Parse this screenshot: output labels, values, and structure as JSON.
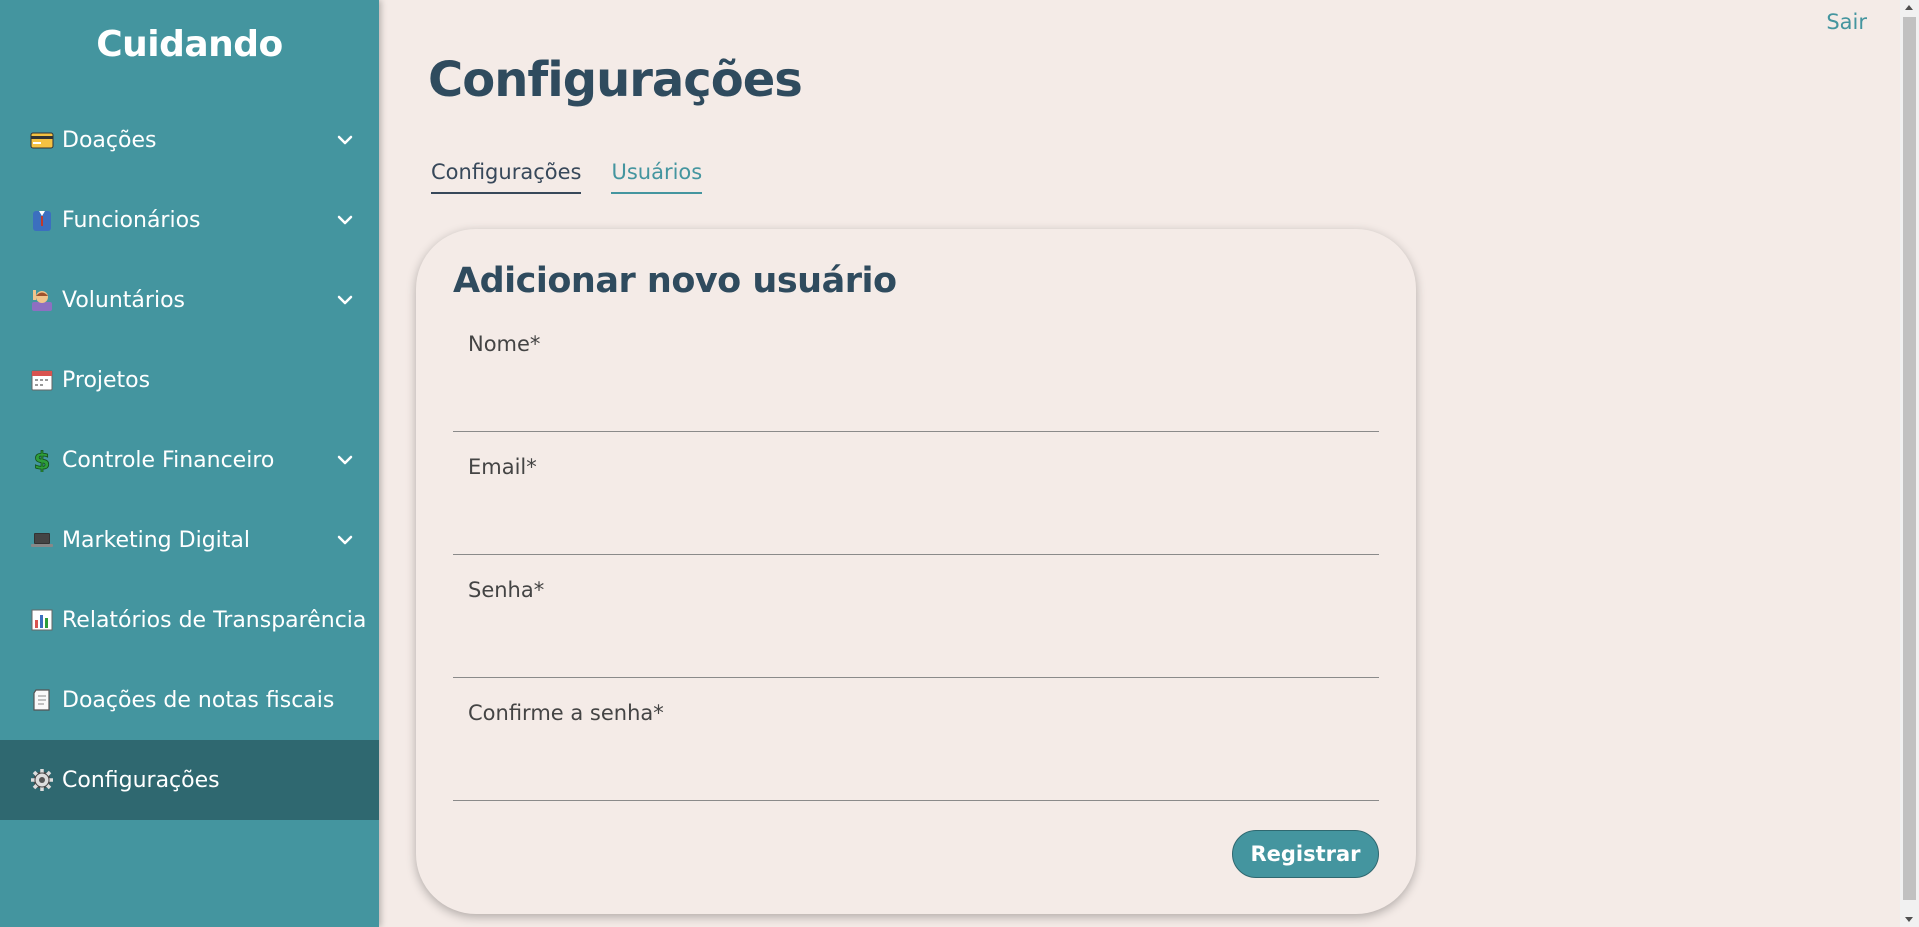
{
  "sidebar": {
    "brand": "Cuidando",
    "items": [
      {
        "label": "Doações",
        "icon": "credit-card-icon",
        "expandable": true
      },
      {
        "label": "Funcionários",
        "icon": "employee-icon",
        "expandable": true
      },
      {
        "label": "Voluntários",
        "icon": "volunteer-icon",
        "expandable": true
      },
      {
        "label": "Projetos",
        "icon": "calendar-icon",
        "expandable": false
      },
      {
        "label": "Controle Financeiro",
        "icon": "dollar-icon",
        "expandable": true
      },
      {
        "label": "Marketing Digital",
        "icon": "laptop-icon",
        "expandable": true
      },
      {
        "label": "Relatórios de Transparência",
        "icon": "bar-chart-icon",
        "expandable": false
      },
      {
        "label": "Doações de notas fiscais",
        "icon": "receipt-icon",
        "expandable": false
      },
      {
        "label": "Configurações",
        "icon": "gear-icon",
        "expandable": false,
        "active": true
      }
    ]
  },
  "header": {
    "logout": "Sair",
    "title": "Configurações"
  },
  "tabs": [
    {
      "label": "Configurações"
    },
    {
      "label": "Usuários",
      "active": true
    }
  ],
  "form": {
    "title": "Adicionar novo usuário",
    "fields": [
      {
        "label": "Nome*",
        "value": ""
      },
      {
        "label": "Email*",
        "value": ""
      },
      {
        "label": "Senha*",
        "value": ""
      },
      {
        "label": "Confirme a senha*",
        "value": ""
      }
    ],
    "submit": "Registrar"
  },
  "colors": {
    "sidebar": "#44959f",
    "sidebar_active": "#2f6870",
    "background": "#f4ebe7",
    "title": "#2f4b5e",
    "accent": "#44959f"
  }
}
